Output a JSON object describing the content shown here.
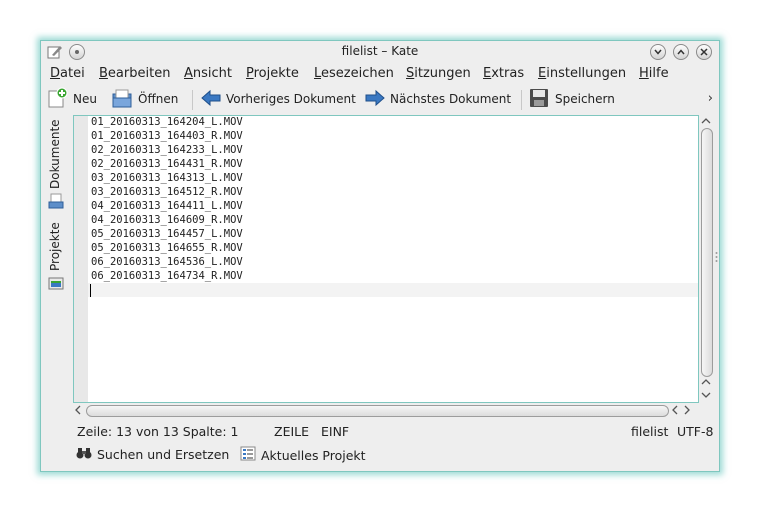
{
  "window": {
    "title": "filelist – Kate"
  },
  "menu": [
    {
      "accel": "D",
      "rest": "atei"
    },
    {
      "accel": "B",
      "rest": "earbeiten"
    },
    {
      "accel": "A",
      "rest": "nsicht"
    },
    {
      "accel": "P",
      "rest": "rojekte"
    },
    {
      "accel": "L",
      "rest": "esezeichen"
    },
    {
      "accel": "S",
      "rest": "itzungen"
    },
    {
      "accel": "E",
      "rest": "xtras"
    },
    {
      "accel": "E",
      "rest": "instellungen"
    },
    {
      "accel": "H",
      "rest": "ilfe"
    }
  ],
  "toolbar": {
    "new_label": "Neu",
    "open_label": "Öffnen",
    "prev_label": "Vorheriges Dokument",
    "next_label": "Nächstes Dokument",
    "save_label": "Speichern",
    "overflow": "›"
  },
  "sidebar": {
    "documents": "Dokumente",
    "projects": "Projekte"
  },
  "editor": {
    "lines": [
      "01_20160313_164204_L.MOV",
      "01_20160313_164403_R.MOV",
      "02_20160313_164233_L.MOV",
      "02_20160313_164431_R.MOV",
      "03_20160313_164313_L.MOV",
      "03_20160313_164512_R.MOV",
      "04_20160313_164411_L.MOV",
      "04_20160313_164609_R.MOV",
      "05_20160313_164457_L.MOV",
      "05_20160313_164655_R.MOV",
      "06_20160313_164536_L.MOV",
      "06_20160313_164734_R.MOV"
    ]
  },
  "status": {
    "position": "Zeile: 13 von 13 Spalte: 1",
    "mode": "ZEILE",
    "insert": "EINF",
    "filename": "filelist",
    "encoding": "UTF-8"
  },
  "bottom": {
    "search_replace": "Suchen und Ersetzen",
    "current_project": "Aktuelles Projekt"
  },
  "colors": {
    "accent": "#7fc7bf",
    "arrow_blue": "#3a78c2"
  }
}
